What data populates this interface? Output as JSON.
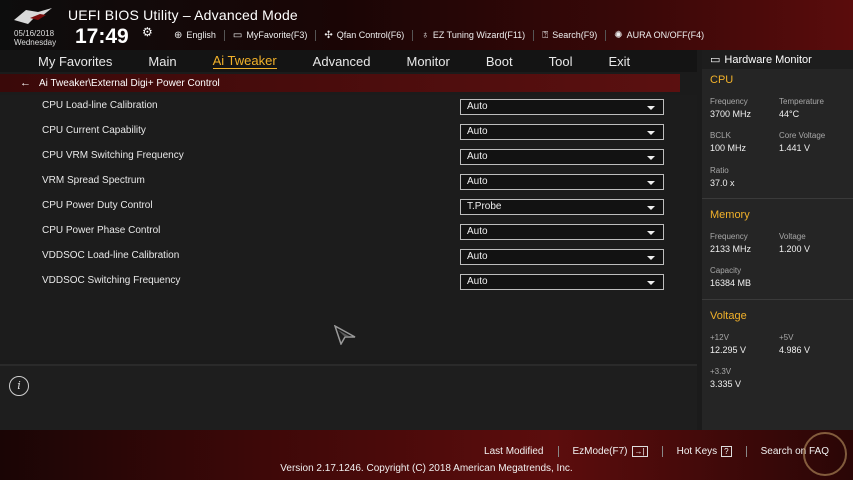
{
  "header": {
    "title": "UEFI BIOS Utility – Advanced Mode",
    "date": "05/16/2018",
    "day": "Wednesday",
    "time": "17:49"
  },
  "toolbar": [
    {
      "icon": "globe-icon",
      "label": "English"
    },
    {
      "icon": "favorite-icon",
      "label": "MyFavorite(F3)"
    },
    {
      "icon": "fan-icon",
      "label": "Qfan Control(F6)"
    },
    {
      "icon": "bulb-icon",
      "label": "EZ Tuning Wizard(F11)"
    },
    {
      "icon": "search-icon",
      "label": "Search(F9)"
    },
    {
      "icon": "aura-icon",
      "label": "AURA ON/OFF(F4)"
    }
  ],
  "menu": [
    {
      "label": "My Favorites"
    },
    {
      "label": "Main"
    },
    {
      "label": "Ai Tweaker",
      "active": true
    },
    {
      "label": "Advanced"
    },
    {
      "label": "Monitor"
    },
    {
      "label": "Boot"
    },
    {
      "label": "Tool"
    },
    {
      "label": "Exit"
    }
  ],
  "breadcrumb": "Ai Tweaker\\External Digi+ Power Control",
  "settings": [
    {
      "label": "CPU Load-line Calibration",
      "value": "Auto"
    },
    {
      "label": "CPU Current Capability",
      "value": "Auto"
    },
    {
      "label": "CPU VRM Switching Frequency",
      "value": "Auto"
    },
    {
      "label": "VRM Spread Spectrum",
      "value": "Auto"
    },
    {
      "label": "CPU Power Duty Control",
      "value": "T.Probe"
    },
    {
      "label": "CPU Power Phase Control",
      "value": "Auto"
    },
    {
      "label": "VDDSOC Load-line Calibration",
      "value": "Auto"
    },
    {
      "label": "VDDSOC Switching Frequency",
      "value": "Auto"
    }
  ],
  "hw_monitor": {
    "title": "Hardware Monitor",
    "cpu": {
      "title": "CPU",
      "frequency_label": "Frequency",
      "frequency": "3700 MHz",
      "temperature_label": "Temperature",
      "temperature": "44°C",
      "bclk_label": "BCLK",
      "bclk": "100 MHz",
      "core_voltage_label": "Core Voltage",
      "core_voltage": "1.441 V",
      "ratio_label": "Ratio",
      "ratio": "37.0 x"
    },
    "memory": {
      "title": "Memory",
      "frequency_label": "Frequency",
      "frequency": "2133 MHz",
      "voltage_label": "Voltage",
      "voltage": "1.200 V",
      "capacity_label": "Capacity",
      "capacity": "16384 MB"
    },
    "voltage": {
      "title": "Voltage",
      "v12_label": "+12V",
      "v12": "12.295 V",
      "v5_label": "+5V",
      "v5": "4.986 V",
      "v33_label": "+3.3V",
      "v33": "3.335 V"
    }
  },
  "bottom": {
    "last_modified": "Last Modified",
    "ezmode": "EzMode(F7)",
    "ezmode_key": "→|",
    "hotkeys": "Hot Keys",
    "hotkeys_key": "?",
    "search_faq": "Search on FAQ",
    "version": "Version 2.17.1246. Copyright (C) 2018 American Megatrends, Inc."
  },
  "colors": {
    "accent": "#f1b12a",
    "brand_red": "#5b1010",
    "panel_bg": "#1c1c1c"
  }
}
